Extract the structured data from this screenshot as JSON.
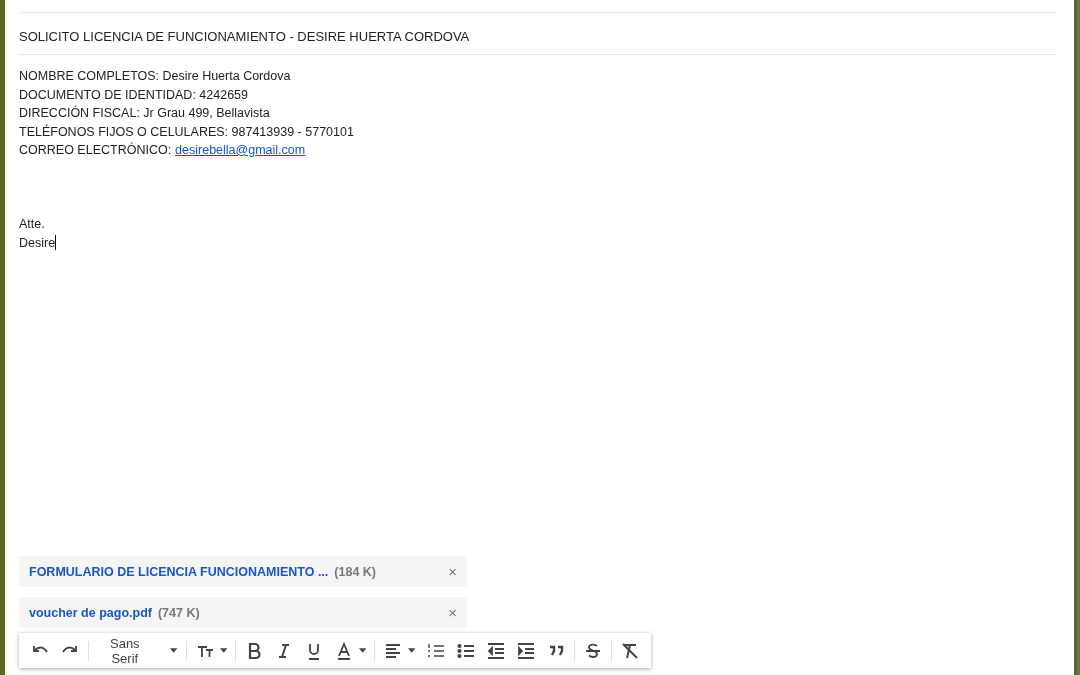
{
  "subject": "SOLICITO LICENCIA DE FUNCIONAMIENTO - DESIRE HUERTA CORDOVA",
  "body": [
    {
      "kind": "text",
      "text": "NOMBRE COMPLETOS: Desire Huerta Cordova"
    },
    {
      "kind": "text",
      "text": "DOCUMENTO DE IDENTIDAD: 4242659"
    },
    {
      "kind": "text",
      "text": "DIRECCIÓN FISCAL: Jr Grau 499, Bellavista"
    },
    {
      "kind": "text",
      "text": "TELÉFONOS FIJOS O CELULARES: 987413939 - 5770101"
    },
    {
      "kind": "link",
      "text": "CORREO ELECTRÓNICO:",
      "link": "desirebella@gmail.com"
    },
    {
      "kind": "blank"
    },
    {
      "kind": "blank"
    },
    {
      "kind": "blank"
    },
    {
      "kind": "text",
      "text": "Atte."
    },
    {
      "kind": "text",
      "text": "Desire",
      "cursor": true
    }
  ],
  "attachments": [
    {
      "name": "FORMULARIO DE LICENCIA FUNCIONAMIENTO ...",
      "size": "(184 K)",
      "close": "×"
    },
    {
      "name": "voucher de pago.pdf",
      "size": "(747 K)",
      "close": "×"
    }
  ],
  "toolbar": {
    "font": "Sans Serif"
  }
}
